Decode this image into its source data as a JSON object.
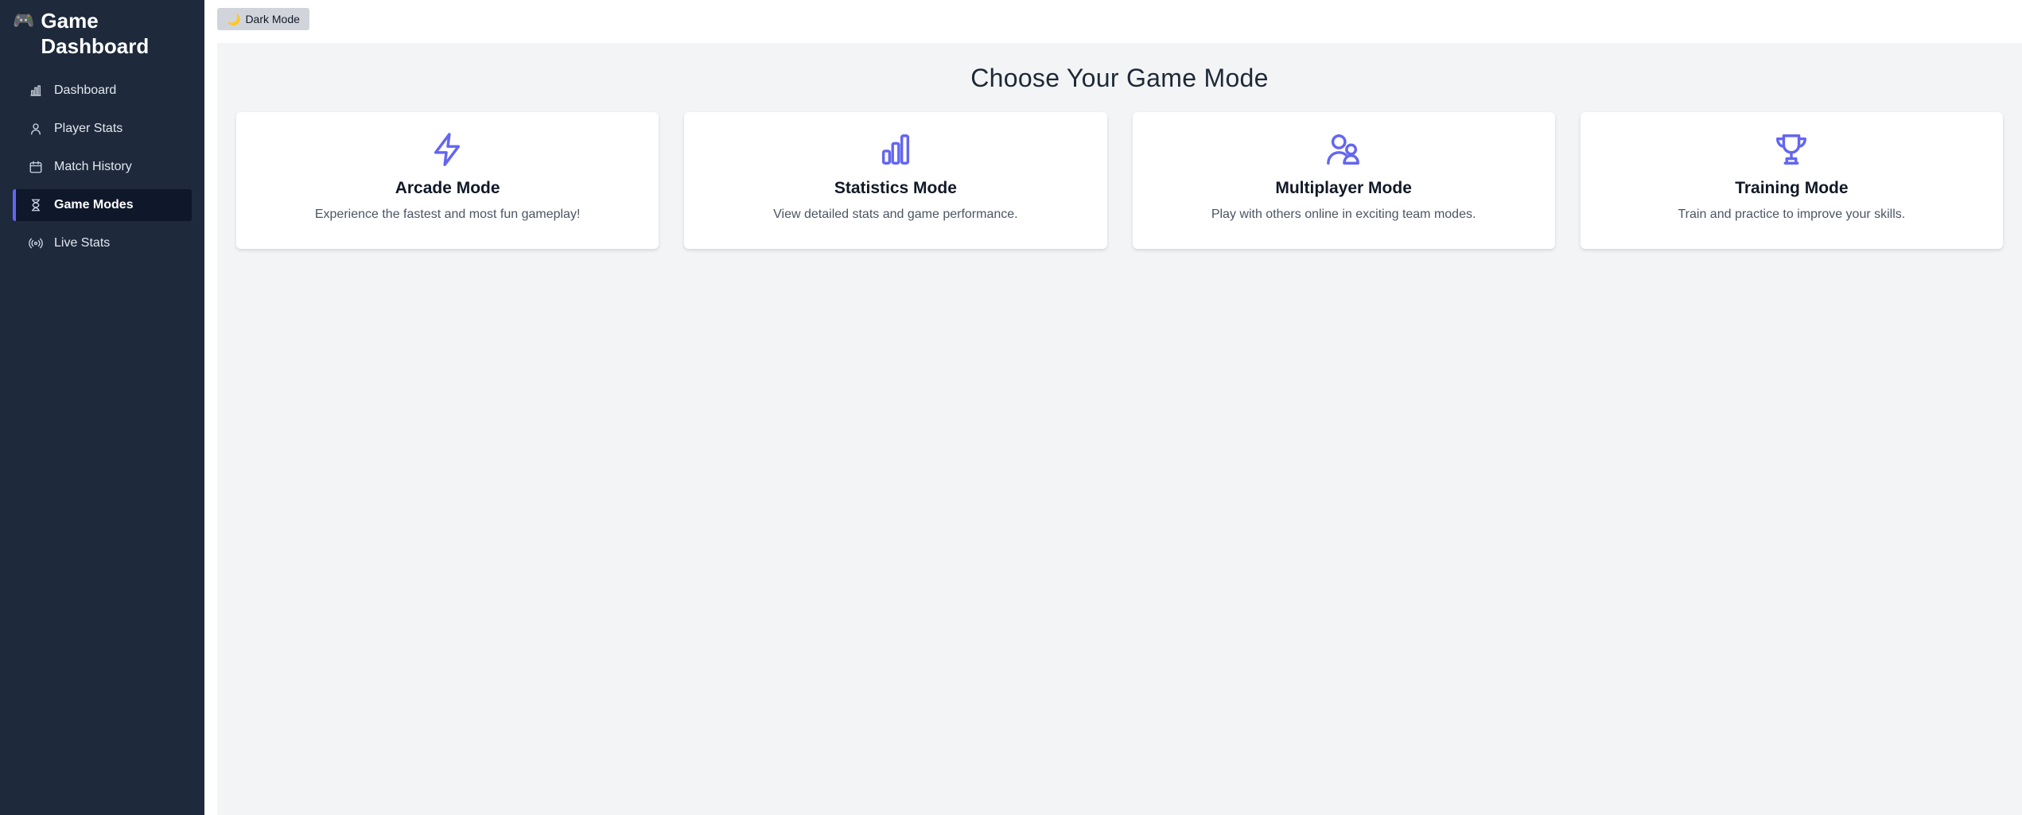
{
  "sidebar": {
    "brand_icon": "🎮",
    "brand_title": "Game Dashboard",
    "items": [
      {
        "label": "Dashboard",
        "icon": "bar-chart-icon"
      },
      {
        "label": "Player Stats",
        "icon": "user-icon"
      },
      {
        "label": "Match History",
        "icon": "calendar-icon"
      },
      {
        "label": "Game Modes",
        "icon": "hourglass-icon",
        "active": true
      },
      {
        "label": "Live Stats",
        "icon": "broadcast-icon"
      }
    ]
  },
  "topbar": {
    "dark_mode_icon": "🌙",
    "dark_mode_label": "Dark Mode"
  },
  "main": {
    "title": "Choose Your Game Mode",
    "cards": [
      {
        "title": "Arcade Mode",
        "description": "Experience the fastest and most fun gameplay!",
        "icon": "lightning-icon"
      },
      {
        "title": "Statistics Mode",
        "description": "View detailed stats and game performance.",
        "icon": "bar-chart-icon"
      },
      {
        "title": "Multiplayer Mode",
        "description": "Play with others online in exciting team modes.",
        "icon": "users-icon"
      },
      {
        "title": "Training Mode",
        "description": "Train and practice to improve your skills.",
        "icon": "trophy-icon"
      }
    ]
  },
  "colors": {
    "sidebar_bg": "#1e293b",
    "accent": "#6366f1",
    "content_bg": "#f3f4f6"
  }
}
